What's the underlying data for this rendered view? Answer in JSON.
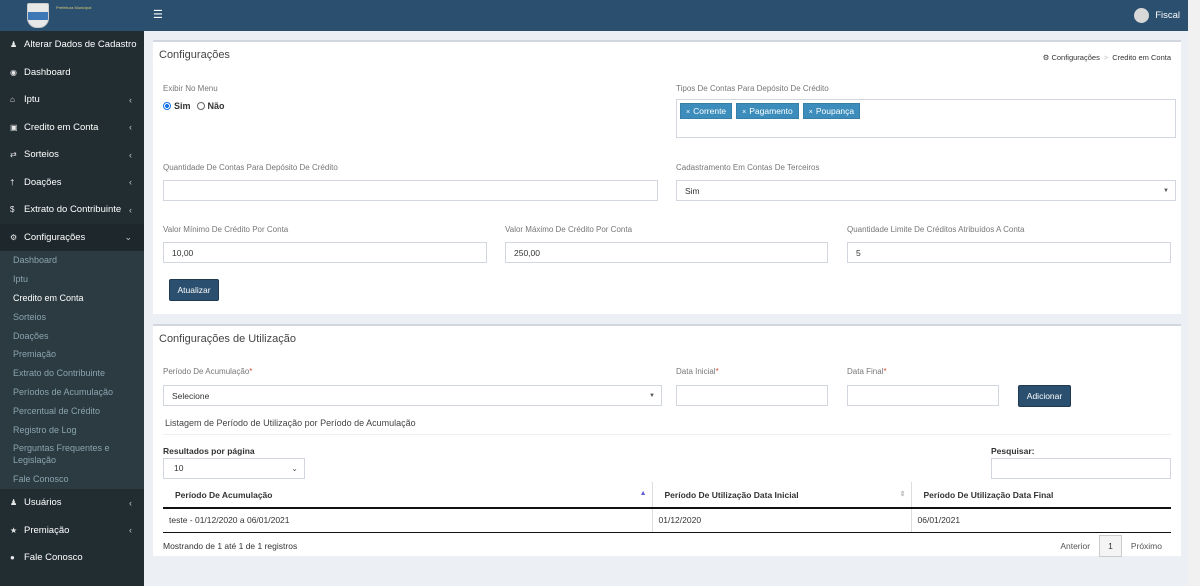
{
  "sidebar": {
    "items": [
      {
        "label": "Alterar Dados de Cadastro",
        "icon": "user-icon"
      },
      {
        "label": "Dashboard",
        "icon": "dashboard-icon"
      },
      {
        "label": "Iptu",
        "icon": "home-icon"
      },
      {
        "label": "Credito em Conta",
        "icon": "money-icon"
      },
      {
        "label": "Sorteios",
        "icon": "random-icon"
      },
      {
        "label": "Doações",
        "icon": "gift-icon"
      },
      {
        "label": "Extrato do Contribuinte",
        "icon": "dollar-icon"
      },
      {
        "label": "Configurações",
        "icon": "gear-icon"
      }
    ],
    "subitems": [
      "Dashboard",
      "Iptu",
      "Credito em Conta",
      "Sorteios",
      "Doações",
      "Premiação",
      "Extrato do Contribuinte",
      "Períodos de Acumulação",
      "Percentual de Crédito",
      "Registro de Log",
      "Perguntas Frequentes e Legislação",
      "Fale Conosco"
    ],
    "bottom_items": [
      {
        "label": "Usuários",
        "icon": "users-icon"
      },
      {
        "label": "Premiação",
        "icon": "trophy-icon"
      },
      {
        "label": "Fale Conosco",
        "icon": "comments-icon"
      }
    ]
  },
  "topbar": {
    "user": "Fiscal"
  },
  "config": {
    "title": "Configurações",
    "breadcrumb": [
      "Configurações",
      "Credito em Conta"
    ],
    "menu_label": "Exibir No Menu",
    "yes": "Sim",
    "no": "Não",
    "tipos_label": "Tipos De Contas Para Depósito De Crédito",
    "tags": [
      "Corrente",
      "Pagamento",
      "Poupança"
    ],
    "qtd_label": "Quantidade De Contas Para Depósito De Crédito",
    "qtd_value": "",
    "terceiros_label": "Cadastramento Em Contas De Terceiros",
    "terceiros_value": "Sim",
    "min_label": "Valor Mínimo De Crédito Por Conta",
    "min_value": "10,00",
    "max_label": "Valor Máximo De Crédito Por Conta",
    "max_value": "250,00",
    "limite_label": "Quantidade Limite De Créditos Atribuídos A Conta",
    "limite_value": "5",
    "update_button": "Atualizar"
  },
  "uso": {
    "title": "Configurações de Utilização",
    "periodo_label": "Período De Acumulação",
    "periodo_value": "Selecione",
    "inicial_label": "Data Inicial",
    "final_label": "Data Final",
    "required_mark": "*",
    "add_button": "Adicionar",
    "list_title": "Listagem de Período de Utilização por Período de Acumulação",
    "per_page_label": "Resultados por página",
    "per_page_value": "10",
    "search_label": "Pesquisar:",
    "columns": [
      "Período De Acumulação",
      "Período De Utilização Data Inicial",
      "Período De Utilização Data Final"
    ],
    "rows": [
      [
        "teste - 01/12/2020 a 06/01/2021",
        "01/12/2020",
        "06/01/2021"
      ]
    ],
    "info": "Mostrando de 1 até 1 de 1 registros",
    "prev": "Anterior",
    "page": "1",
    "next": "Próximo"
  }
}
